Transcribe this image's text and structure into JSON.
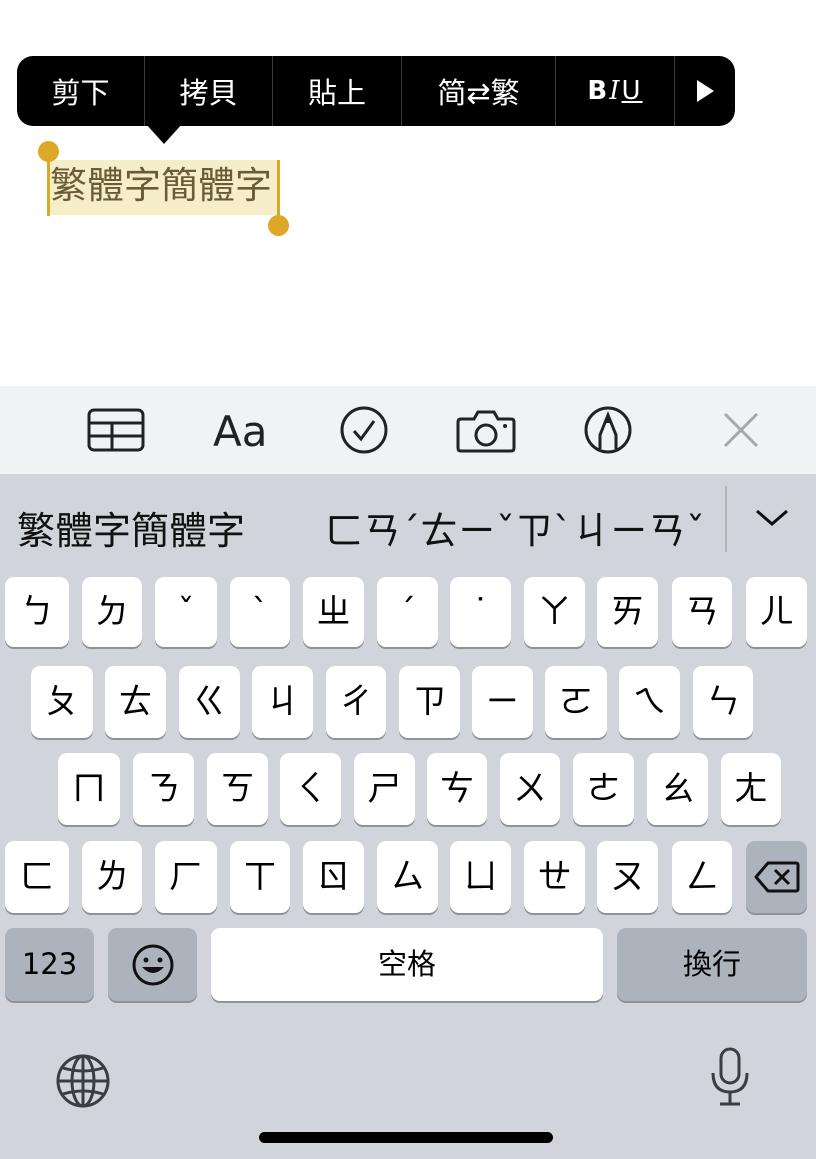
{
  "edit_menu": {
    "cut": "剪下",
    "copy": "拷貝",
    "paste": "貼上",
    "convert": "简⇄繁",
    "format_b": "B",
    "format_i": "I",
    "format_u": "U"
  },
  "note": {
    "selected_text": "繁體字簡體字"
  },
  "candidate_bar": {
    "candidate": "繁體字簡體字",
    "composition": "ㄈㄢˊㄊㄧˇㄗˋㄐㄧㄢˇ"
  },
  "keyboard": {
    "row1": [
      "ㄅ",
      "ㄉ",
      "ˇ",
      "ˋ",
      "ㄓ",
      "ˊ",
      "˙",
      "ㄚ",
      "ㄞ",
      "ㄢ",
      "ㄦ"
    ],
    "row2": [
      "ㄆ",
      "ㄊ",
      "ㄍ",
      "ㄐ",
      "ㄔ",
      "ㄗ",
      "ㄧ",
      "ㄛ",
      "ㄟ",
      "ㄣ"
    ],
    "row3": [
      "ㄇ",
      "ㄋ",
      "ㄎ",
      "ㄑ",
      "ㄕ",
      "ㄘ",
      "ㄨ",
      "ㄜ",
      "ㄠ",
      "ㄤ"
    ],
    "row4": [
      "ㄈ",
      "ㄌ",
      "ㄏ",
      "ㄒ",
      "ㄖ",
      "ㄙ",
      "ㄩ",
      "ㄝ",
      "ㄡ",
      "ㄥ"
    ],
    "numbers_key": "123",
    "space_key": "空格",
    "return_key": "換行"
  },
  "colors": {
    "selection_handle": "#dca826",
    "selection_fill": "#f6eec8",
    "keyboard_bg": "#d1d4db"
  },
  "icons": [
    "table-icon",
    "format-icon",
    "checklist-icon",
    "camera-icon",
    "markup-icon",
    "close-icon",
    "chevron-down-icon",
    "delete-icon",
    "emoji-icon",
    "globe-icon",
    "microphone-icon"
  ]
}
